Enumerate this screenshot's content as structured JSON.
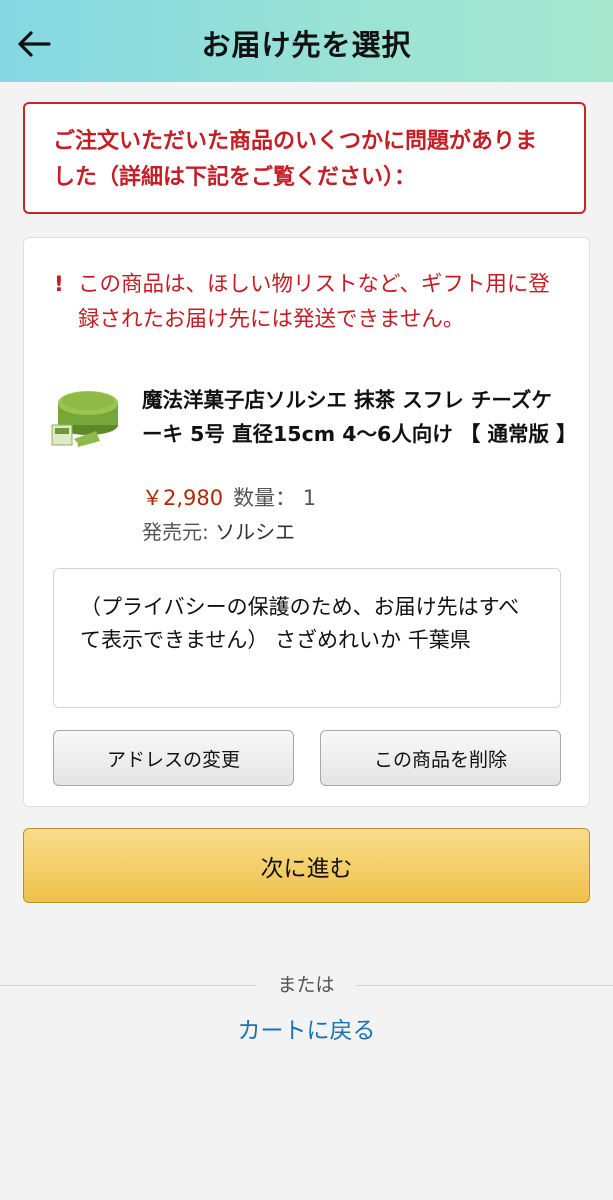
{
  "header": {
    "title": "お届け先を選択",
    "back_icon": "arrow-left-icon"
  },
  "alert": {
    "message": "ご注文いただいた商品のいくつかに問題がありました（詳細は下記をご覧ください）："
  },
  "item": {
    "warning_mark": "!",
    "warning": "この商品は、ほしい物リストなど、ギフト用に登録されたお届け先には発送できません。",
    "image_icon": "matcha-cheesecake-image",
    "title": "魔法洋菓子店ソルシエ 抹茶 スフレ チーズケーキ 5号 直径15cm 4〜6人向け 【 通常版 】",
    "price": "￥2,980",
    "quantity": "数量： 1",
    "seller_label": "発売元:",
    "seller_name": "ソルシエ",
    "address": "（プライバシーの保護のため、お届け先はすべて表示できません） さざめれいか 千葉県",
    "change_address_label": "アドレスの変更",
    "delete_item_label": "この商品を削除"
  },
  "actions": {
    "next_label": "次に進む",
    "or_label": "または",
    "back_to_cart_label": "カートに戻る"
  },
  "colors": {
    "error": "#c41e24",
    "price": "#b12704",
    "link": "#1a73b5",
    "primary_button": "#f0c14b"
  }
}
